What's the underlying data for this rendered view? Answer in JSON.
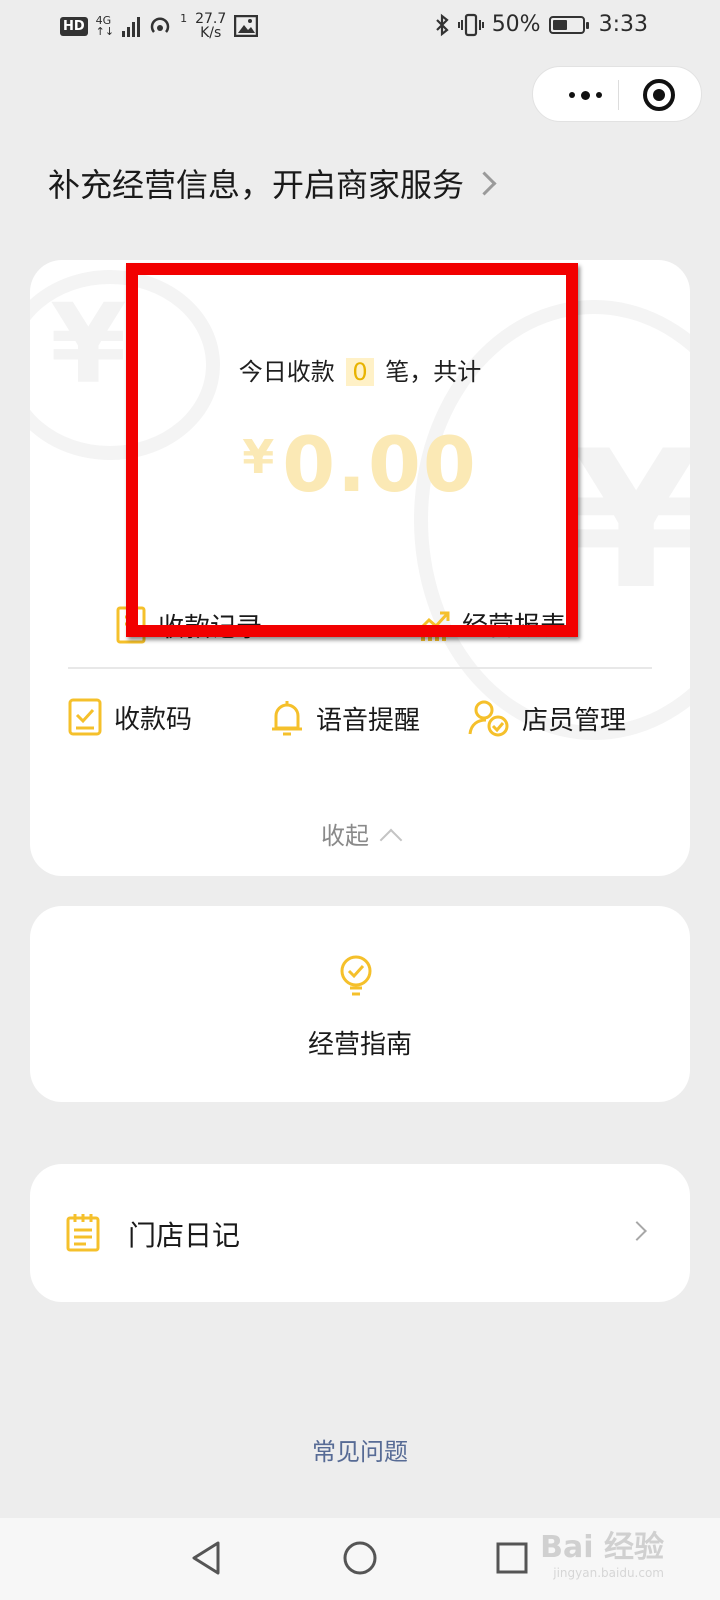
{
  "status_bar": {
    "hd": "HD",
    "network": "4G",
    "network_sub": "↑↓",
    "hotspot_count": "1",
    "speed_value": "27.7",
    "speed_unit": "K/s",
    "battery_percent": "50%",
    "time": "3:33"
  },
  "header": {
    "info_prompt": "补充经营信息，开启商家服务"
  },
  "summary": {
    "today_prefix": "今日收款",
    "today_count": "0",
    "today_suffix": "笔，共计",
    "currency": "¥",
    "amount": "0.00",
    "records_label": "收款记录",
    "report_label": "经营报表"
  },
  "tools": [
    {
      "label": "收款码",
      "icon": "qr-code-card-icon"
    },
    {
      "label": "语音提醒",
      "icon": "bell-icon"
    },
    {
      "label": "店员管理",
      "icon": "staff-check-icon"
    }
  ],
  "collapse_label": "收起",
  "guide": {
    "label": "经营指南",
    "icon": "lightbulb-check-icon"
  },
  "diary": {
    "label": "门店日记",
    "icon": "notepad-icon"
  },
  "faq_label": "常见问题",
  "watermark": {
    "text": "Bai 经验",
    "sub": "jingyan.baidu.com"
  },
  "colors": {
    "accent": "#f5c02b",
    "highlight_box": "#f20000",
    "link": "#576b95",
    "background": "#ededed"
  }
}
